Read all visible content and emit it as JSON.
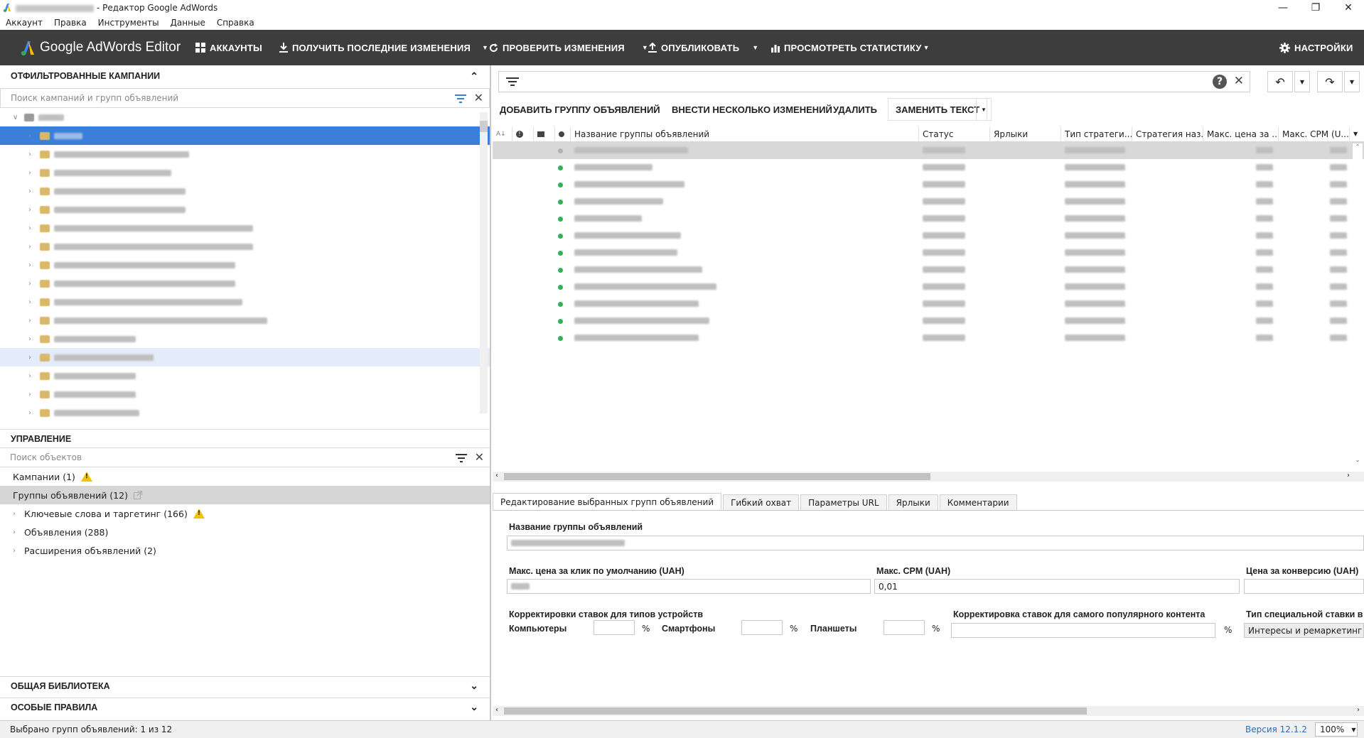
{
  "window": {
    "title": "- Редактор Google AdWords"
  },
  "menu": [
    "Аккаунт",
    "Правка",
    "Инструменты",
    "Данные",
    "Справка"
  ],
  "toolbar": {
    "brand": "Google AdWords Editor",
    "accounts": "АККАУНТЫ",
    "get_changes": "ПОЛУЧИТЬ ПОСЛЕДНИЕ ИЗМЕНЕНИЯ",
    "check_changes": "ПРОВЕРИТЬ ИЗМЕНЕНИЯ",
    "publish": "ОПУБЛИКОВАТЬ",
    "view_stats": "ПРОСМОТРЕТЬ СТАТИСТИКУ",
    "settings": "НАСТРОЙКИ"
  },
  "left": {
    "campaigns_header": "ОТФИЛЬТРОВАННЫЕ КАМПАНИИ",
    "campaign_search_placeholder": "Поиск кампаний и групп объявлений",
    "management_header": "УПРАВЛЕНИЕ",
    "object_search_placeholder": "Поиск объектов",
    "management_items": [
      "Кампании (1)",
      "Группы объявлений (12)",
      "Ключевые слова и таргетинг (166)",
      "Объявления (288)",
      "Расширения объявлений (2)"
    ],
    "library_header": "ОБЩАЯ БИБЛИОТЕКА",
    "rules_header": "ОСОБЫЕ ПРАВИЛА"
  },
  "actions": {
    "add_group": "ДОБАВИТЬ ГРУППУ ОБЪЯВЛЕНИЙ",
    "multi_edit": "ВНЕСТИ НЕСКОЛЬКО ИЗМЕНЕНИЙ",
    "delete": "УДАЛИТЬ",
    "replace_text": "ЗАМЕНИТЬ ТЕКСТ"
  },
  "grid": {
    "columns": [
      "Название группы объявлений",
      "Статус",
      "Ярлыки",
      "Тип стратеги...",
      "Стратегия наз...",
      "Макс. цена за ...",
      "Макс. CPM (U..."
    ],
    "row_count": 12
  },
  "tabs": [
    "Редактирование выбранных групп объявлений",
    "Гибкий охват",
    "Параметры URL",
    "Ярлыки",
    "Комментарии"
  ],
  "form": {
    "group_name_label": "Название группы объявлений",
    "max_cpc_label": "Макс. цена за клик по умолчанию (UAH)",
    "max_cpm_label": "Макс. CPM (UAH)",
    "max_cpm_value": "0,01",
    "cpa_label": "Цена за конверсию (UAH)",
    "device_adj_label": "Корректировки ставок для типов устройств",
    "computers_label": "Компьютеры",
    "smartphones_label": "Смартфоны",
    "tablets_label": "Планшеты",
    "percent": "%",
    "popular_adj_label": "Корректировка ставок для самого популярного контента",
    "special_bid_label": "Тип специальной ставки в",
    "special_bid_value": "Интересы и ремаркетинг"
  },
  "status": {
    "selected": "Выбрано групп объявлений: 1 из 12",
    "version": "Версия 12.1.2",
    "zoom": "100%"
  }
}
